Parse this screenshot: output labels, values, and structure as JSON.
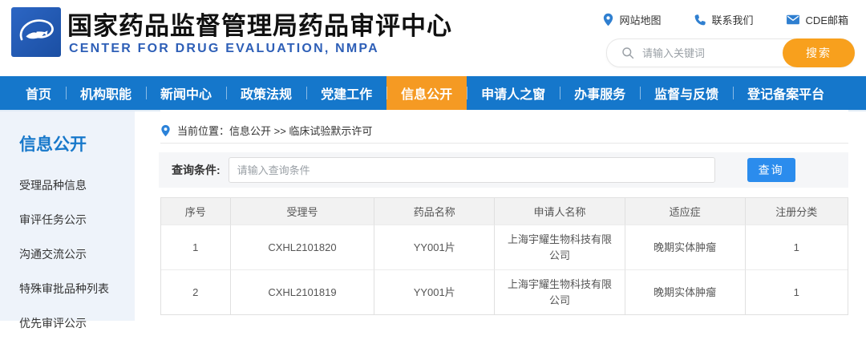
{
  "header": {
    "title": "国家药品监督管理局药品审评中心",
    "subtitle": "CENTER FOR DRUG EVALUATION, NMPA",
    "links": [
      {
        "icon": "pin-icon",
        "label": "网站地图"
      },
      {
        "icon": "phone-icon",
        "label": "联系我们"
      },
      {
        "icon": "mail-icon",
        "label": "CDE邮箱"
      }
    ],
    "search": {
      "placeholder": "请输入关键词",
      "button": "搜索"
    }
  },
  "nav": {
    "items": [
      "首页",
      "机构职能",
      "新闻中心",
      "政策法规",
      "党建工作",
      "信息公开",
      "申请人之窗",
      "办事服务",
      "监督与反馈",
      "登记备案平台"
    ],
    "active": "信息公开"
  },
  "sidebar": {
    "title": "信息公开",
    "items": [
      "受理品种信息",
      "审评任务公示",
      "沟通交流公示",
      "特殊审批品种列表",
      "优先审评公示"
    ]
  },
  "main": {
    "breadcrumb": "当前位置：信息公开 >> 临床试验默示许可",
    "query": {
      "label": "查询条件:",
      "placeholder": "请输入查询条件",
      "button": "查询"
    },
    "table": {
      "headers": [
        "序号",
        "受理号",
        "药品名称",
        "申请人名称",
        "适应症",
        "注册分类"
      ],
      "rows": [
        [
          "1",
          "CXHL2101820",
          "YY001片",
          "上海宇耀生物科技有限公司",
          "晚期实体肿瘤",
          "1"
        ],
        [
          "2",
          "CXHL2101819",
          "YY001片",
          "上海宇耀生物科技有限公司",
          "晚期实体肿瘤",
          "1"
        ]
      ]
    }
  },
  "colors": {
    "nav_blue": "#1577cb",
    "active_orange": "#f59a23",
    "search_orange": "#f8a01d",
    "query_button_blue": "#2b8ced",
    "sidebar_bg": "#eef3fa",
    "sidebar_title_blue": "#1778ca",
    "subtitle_blue": "#2e5fb7",
    "link_icon_blue": "#2f7fd0"
  }
}
